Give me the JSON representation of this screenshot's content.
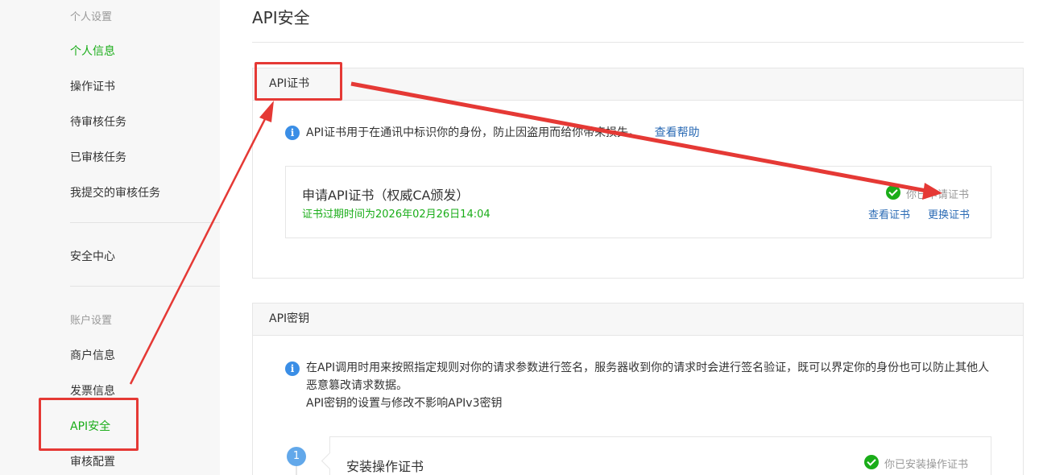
{
  "sidebar": {
    "section_personal": "个人设置",
    "items_personal": [
      "个人信息",
      "操作证书",
      "待审核任务",
      "已审核任务",
      "我提交的审核任务"
    ],
    "security_center": "安全中心",
    "section_account": "账户设置",
    "items_account": [
      "商户信息",
      "发票信息",
      "API安全",
      "审核配置"
    ]
  },
  "page": {
    "title": "API安全"
  },
  "cert_panel": {
    "header": "API证书",
    "info_text": "API证书用于在通讯中标识你的身份，防止因盗用而给你带来损失。",
    "help_link": "查看帮助",
    "box": {
      "title": "申请API证书（权威CA颁发）",
      "expire": "证书过期时间为2026年02月26日14:04",
      "status": "你已申请证书",
      "view_link": "查看证书",
      "replace_link": "更换证书"
    }
  },
  "key_panel": {
    "header": "API密钥",
    "info_line1": "在API调用时用来按照指定规则对你的请求参数进行签名，服务器收到你的请求时会进行签名验证，既可以界定你的身份也可以防止其他人",
    "info_line2": "恶意篡改请求数据。",
    "info_line3": "API密钥的设置与修改不影响APIv3密钥",
    "step": {
      "number": "1",
      "title": "安装操作证书",
      "status": "你已安装操作证书"
    }
  },
  "colors": {
    "accent_green": "#1aad19",
    "link_blue": "#2b6bb5",
    "annotation_red": "#e53935"
  }
}
